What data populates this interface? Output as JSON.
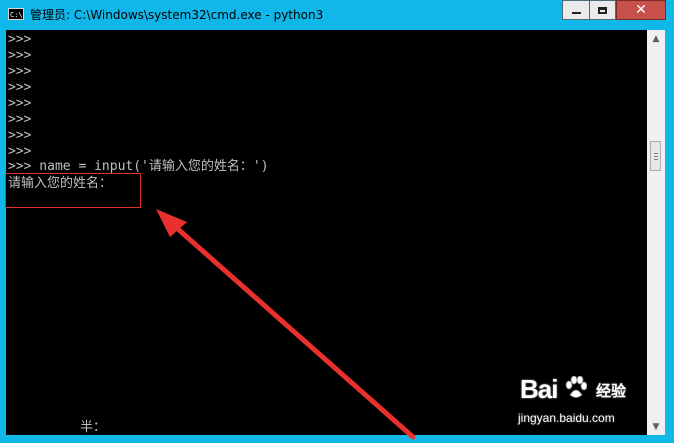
{
  "window": {
    "title": "管理员: C:\\Windows\\system32\\cmd.exe - python3",
    "app_icon_text": "C:\\",
    "controls": {
      "minimize_icon": "minimize-icon",
      "maximize_icon": "maximize-icon",
      "close_icon": "close-icon",
      "close_glyph": "✕"
    }
  },
  "console": {
    "prompt_lines": [
      ">>>",
      ">>>",
      ">>>",
      ">>>",
      ">>>",
      ">>>",
      ">>>",
      ">>>"
    ],
    "command_line": ">>> name = input('请输入您的姓名：')",
    "output_line": "请输入您的姓名：",
    "ime_indicator": "半："
  },
  "scrollbar": {
    "up_arrow": "▲",
    "down_arrow": "▼"
  },
  "annotation": {
    "highlight_color": "#e0312d",
    "arrow_color": "#e8302c"
  },
  "watermark": {
    "logo_text": "Bai",
    "logo_suffix": "经验",
    "url": "jingyan.baidu.com"
  },
  "colors": {
    "title_bar": "#10b8ea",
    "console_background": "#000000",
    "console_text": "#c0c0c0",
    "close_button": "#c7504a"
  }
}
